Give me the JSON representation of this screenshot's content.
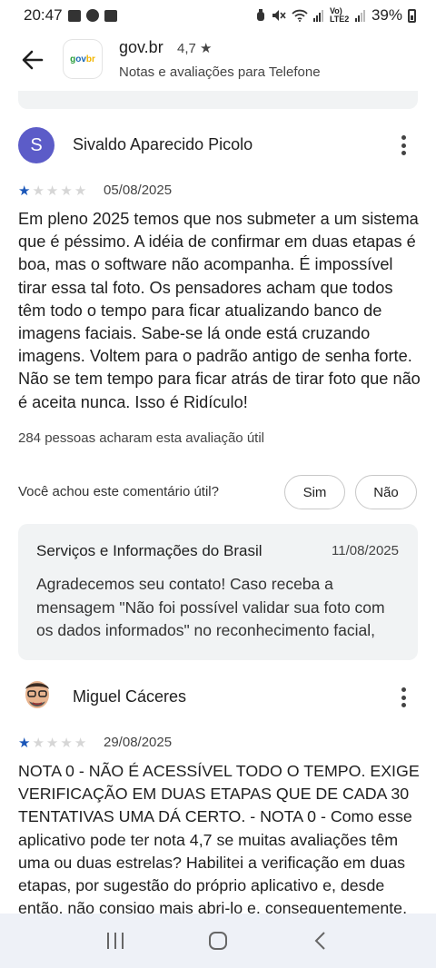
{
  "status_bar": {
    "time": "20:47",
    "battery": "39%",
    "network_label": "Vo) LTE2"
  },
  "header": {
    "app_name": "gov.br",
    "app_rating": "4,7 ★",
    "subtitle": "Notas e avaliações para Telefone",
    "logo_text": [
      "g",
      "ov",
      "br"
    ]
  },
  "review1": {
    "avatar_letter": "S",
    "name": "Sivaldo Aparecido Picolo",
    "rating_stars": 1,
    "date": "05/08/2025",
    "text": "Em pleno 2025 temos que nos submeter a um sistema que é péssimo. A idéia de confirmar em duas etapas é boa, mas o software não acompanha. É impossível tirar essa tal foto. Os pensadores acham que todos têm todo o tempo para ficar atualizando banco de imagens faciais. Sabe-se lá onde está cruzando imagens. Voltem para o padrão antigo de senha forte. Não se tem tempo para ficar atrás de tirar foto que não é aceita nunca. Isso é Ridículo!",
    "helpful_count": "284 pessoas acharam esta avaliação útil",
    "helpful_question": "Você achou este comentário útil?",
    "yes_label": "Sim",
    "no_label": "Não"
  },
  "developer_reply": {
    "name": "Serviços e Informações do Brasil",
    "date": "11/08/2025",
    "text": "Agradecemos seu contato! Caso receba a mensagem \"Não foi possível validar sua foto com os dados informados\" no reconhecimento facial,"
  },
  "review2": {
    "name": "Miguel Cáceres",
    "rating_stars": 1,
    "date": "29/08/2025",
    "text": "NOTA 0 - NÃO É ACESSÍVEL TODO O TEMPO. EXIGE VERIFICAÇÃO EM DUAS ETAPAS QUE DE CADA 30 TENTATIVAS UMA DÁ CERTO. - NOTA 0 - Como esse aplicativo pode ter nota 4,7 se muitas avaliações têm uma ou duas estrelas? Habilitei a verificação em duas etapas, por sugestão do próprio aplicativo e, desde então, não consigo mais abri-lo e, consequentemente,"
  },
  "colors": {
    "accent": "#1a56b8",
    "avatar_bg": "#5c5cc8",
    "card_bg": "#f1f3f4",
    "nav_bg": "#eef1f7"
  }
}
